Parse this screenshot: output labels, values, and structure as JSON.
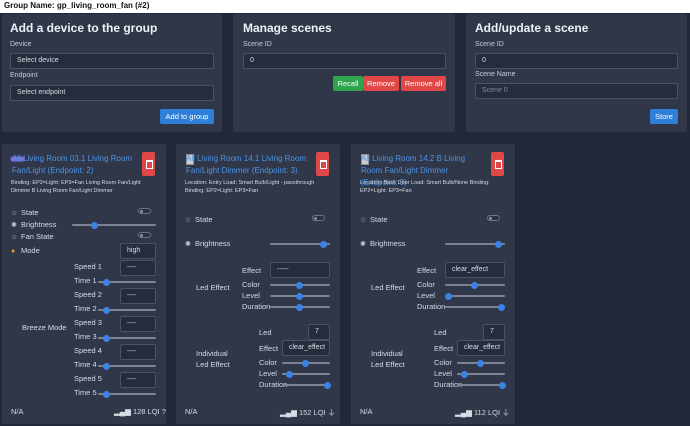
{
  "header": {
    "group_name": "Group Name: gp_living_room_fan (#2)"
  },
  "add_device": {
    "title": "Add a device to the group",
    "device_label": "Device",
    "device_value": "Select device",
    "endpoint_label": "Endpoint",
    "endpoint_value": "Select endpoint",
    "button": "Add to group"
  },
  "manage_scenes": {
    "title": "Manage scenes",
    "scene_id_label": "Scene ID",
    "scene_id_value": "0",
    "recall": "Recall",
    "remove": "Remove",
    "remove_all": "Remove all"
  },
  "update_scene": {
    "title": "Add/update a scene",
    "scene_id_label": "Scene ID",
    "scene_id_value": "0",
    "scene_name_label": "Scene Name",
    "scene_name_placeholder": "Scene 0",
    "button": "Store"
  },
  "devices": [
    {
      "name": "All Living Room 03.1 Living Room Fan/Light (Endpoint: 2)",
      "binding": "Binding: EP2=Light: EP3=Fan Living Room Fan/Light Dimmer B Living Room Fan/Light Dimmer",
      "state": "State",
      "brightness": "Brightness",
      "fan_state": "Fan State",
      "mode": "Mode",
      "mode_value": "high",
      "breeze": "Breeze Mode",
      "speeds": [
        {
          "s": "Speed 1",
          "sv": "----",
          "t": "Time 1",
          "tv": 0.1
        },
        {
          "s": "Speed 2",
          "sv": "----",
          "t": "Time 2",
          "tv": 0.1
        },
        {
          "s": "Speed 3",
          "sv": "----",
          "t": "Time 3",
          "tv": 0.1
        },
        {
          "s": "Speed 4",
          "sv": "----",
          "t": "Time 4",
          "tv": 0.1
        },
        {
          "s": "Speed 5",
          "sv": "----",
          "t": "Time 5",
          "tv": 0.1
        }
      ],
      "brightness_level": 0.25,
      "footer": "N/A",
      "lqi": "128 LQI",
      "status": "?"
    },
    {
      "name": "All Living Room 14.1 Living Room Fan/Light Dimmer (Endpoint: 3)",
      "location": "Location: Entry Load: Smart Bulb/Light - passthrough Binding: EP2=Light: EP3=Fan",
      "state": "State",
      "brightness": "Brightness",
      "brightness_level": 0.95,
      "led_effect": "Led Effect",
      "effect": "Effect",
      "effect_value": "-----",
      "color": "Color",
      "level": "Level",
      "duration": "Duration",
      "individual": "Individual Led Effect",
      "led": "Led",
      "led_value": "7",
      "ind_effect_value": "clear_effect",
      "footer": "N/A",
      "lqi": "152 LQI"
    },
    {
      "name": "All Living Room 14.2 B Living Room Fan/Light Dimmer (Endpoint: 3)",
      "location": "Location: Back Door Load: Smart Bulb/None Binding: EP2=Light: EP3=Fan",
      "state": "State",
      "brightness": "Brightness",
      "brightness_level": 0.95,
      "led_effect": "Led Effect",
      "effect": "Effect",
      "effect_value": "clear_effect",
      "color": "Color",
      "level": "Level",
      "duration": "Duration",
      "individual": "Individual Led Effect",
      "led": "Led",
      "led_value": "7",
      "ind_effect_value": "clear_effect",
      "footer": "N/A",
      "lqi": "112 LQI"
    }
  ]
}
